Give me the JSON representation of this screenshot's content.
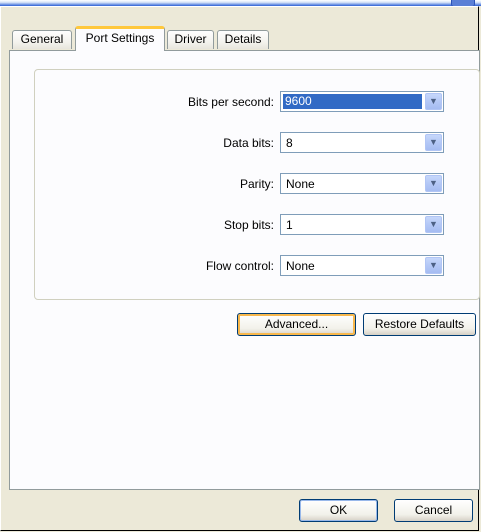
{
  "window": {
    "title_fragment": ""
  },
  "tabs": [
    {
      "label": "General",
      "active": false
    },
    {
      "label": "Port Settings",
      "active": true
    },
    {
      "label": "Driver",
      "active": false
    },
    {
      "label": "Details",
      "active": false
    }
  ],
  "port_settings": {
    "fields": [
      {
        "label": "Bits per second:",
        "value": "9600",
        "selected": true
      },
      {
        "label": "Data bits:",
        "value": "8",
        "selected": false
      },
      {
        "label": "Parity:",
        "value": "None",
        "selected": false
      },
      {
        "label": "Stop bits:",
        "value": "1",
        "selected": false
      },
      {
        "label": "Flow control:",
        "value": "None",
        "selected": false
      }
    ],
    "advanced_label": "Advanced...",
    "restore_label": "Restore Defaults"
  },
  "footer": {
    "ok_label": "OK",
    "cancel_label": "Cancel"
  },
  "colors": {
    "background": "#ece9d8",
    "panel": "#fcfcfe",
    "selection": "#316ac5",
    "focus": "#f8b84d"
  },
  "icons": {
    "dropdown": "chevron-down-icon"
  }
}
